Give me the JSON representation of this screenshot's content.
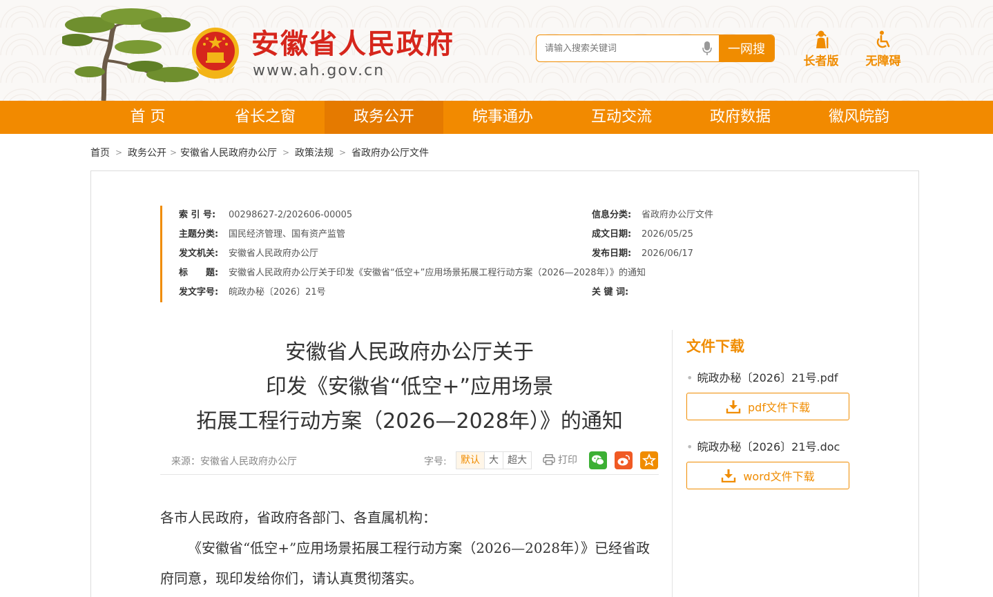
{
  "header": {
    "site_title": "安徽省人民政府",
    "site_url": "www.ah.gov.cn",
    "search_placeholder": "请输入搜索关键词",
    "search_button": "一网搜",
    "elderly_label": "长者版",
    "accessible_label": "无障碍"
  },
  "nav": {
    "items": [
      "首 页",
      "省长之窗",
      "政务公开",
      "皖事通办",
      "互动交流",
      "政府数据",
      "徽风皖韵"
    ],
    "active_index": 2
  },
  "breadcrumb": [
    "首页",
    "政务公开",
    "安徽省人民政府办公厅",
    "政策法规",
    "省政府办公厅文件"
  ],
  "meta": {
    "index_no_key": "索 引 号:",
    "index_no": "00298627-2/202606-00005",
    "info_cat_key": "信息分类:",
    "info_cat": "省政府办公厅文件",
    "topic_key": "主题分类:",
    "topic": "国民经济管理、国有资产监管",
    "date_made_key": "成文日期:",
    "date_made": "2026/05/25",
    "issuer_key": "发文机关:",
    "issuer": "安徽省人民政府办公厅",
    "date_pub_key": "发布日期:",
    "date_pub": "2026/06/17",
    "title_key": "标　　题:",
    "title": "安徽省人民政府办公厅关于印发《安徽省“低空+”应用场景拓展工程行动方案（2026—2028年）》的通知",
    "doc_no_key": "发文字号:",
    "doc_no": "皖政办秘〔2026〕21号",
    "keywords_key": "关 键 词:",
    "keywords": ""
  },
  "article": {
    "title_line1": "安徽省人民政府办公厅关于",
    "title_line2": "印发《安徽省“低空+”应用场景",
    "title_line3": "拓展工程行动方案（2026—2028年）》的通知",
    "source": "来源：安徽省人民政府办公厅",
    "font_size_label": "字号:",
    "font_sizes": [
      "默认",
      "大",
      "超大"
    ],
    "print_label": "打印",
    "salutation": "各市人民政府，省政府各部门、各直属机构：",
    "para1": "《安徽省“低空+”应用场景拓展工程行动方案（2026—2028年）》已经省政府同意，现印发给你们，请认真贯彻落实。"
  },
  "downloads": {
    "title": "文件下载",
    "pdf_name": "皖政办秘〔2026〕21号.pdf",
    "pdf_button": "pdf文件下载",
    "doc_name": "皖政办秘〔2026〕21号.doc",
    "doc_button": "word文件下载"
  },
  "colors": {
    "accent": "#f08c00",
    "nav_bg": "#f28a00",
    "title_red": "#d6261c"
  }
}
